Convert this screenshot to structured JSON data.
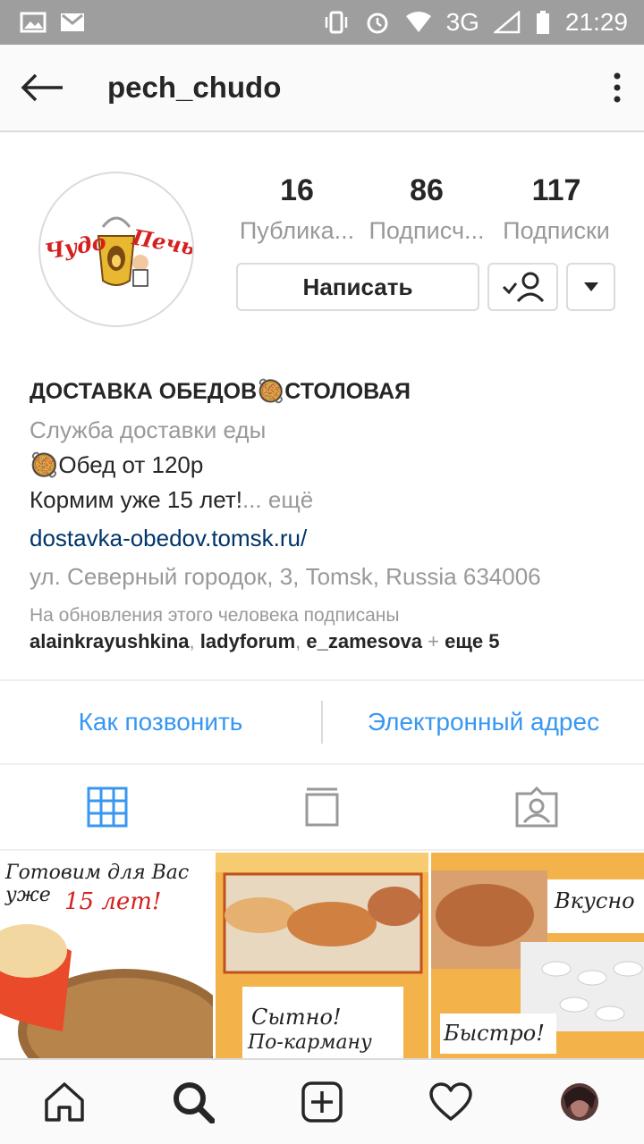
{
  "status_bar": {
    "network": "3G",
    "time": "21:29"
  },
  "header": {
    "username": "pech_chudo"
  },
  "avatar": {
    "logo_text": "ЧудоПечь"
  },
  "stats": [
    {
      "value": "16",
      "label": "Публика..."
    },
    {
      "value": "86",
      "label": "Подписч..."
    },
    {
      "value": "117",
      "label": "Подписки"
    }
  ],
  "buttons": {
    "message": "Написать"
  },
  "bio": {
    "name": "ДОСТАВКА ОБЕДОВ🥘СТОЛОВАЯ",
    "category": "Служба доставки еды",
    "line1": "🥘Обед от 120р",
    "line2": "Кормим уже 15 лет!",
    "more": "... ещё",
    "link": "dostavka-obedov.tomsk.ru/",
    "address": "ул. Северный городок, 3, Tomsk, Russia 634006",
    "followed_by_label": "На обновления этого человека подписаны",
    "follower1": "alainkrayushkina",
    "follower2": "ladyforum",
    "follower3": "e_zamesova",
    "plus": " + ",
    "more_count": "еще 5",
    "comma": ", "
  },
  "contact": {
    "call": "Как позвонить",
    "email": "Электронный адрес"
  },
  "grid": [
    {
      "caption1": "Готовим для Вас уже",
      "caption2": "15 лет!"
    },
    {
      "caption1": "Сытно!",
      "caption2": "По-карману"
    },
    {
      "caption1": "Вкусно",
      "caption2": "Быстро!"
    }
  ],
  "colors": {
    "link_blue": "#3897f0",
    "url_blue": "#003569",
    "grey_text": "#999999",
    "border": "#dbdbdb"
  }
}
